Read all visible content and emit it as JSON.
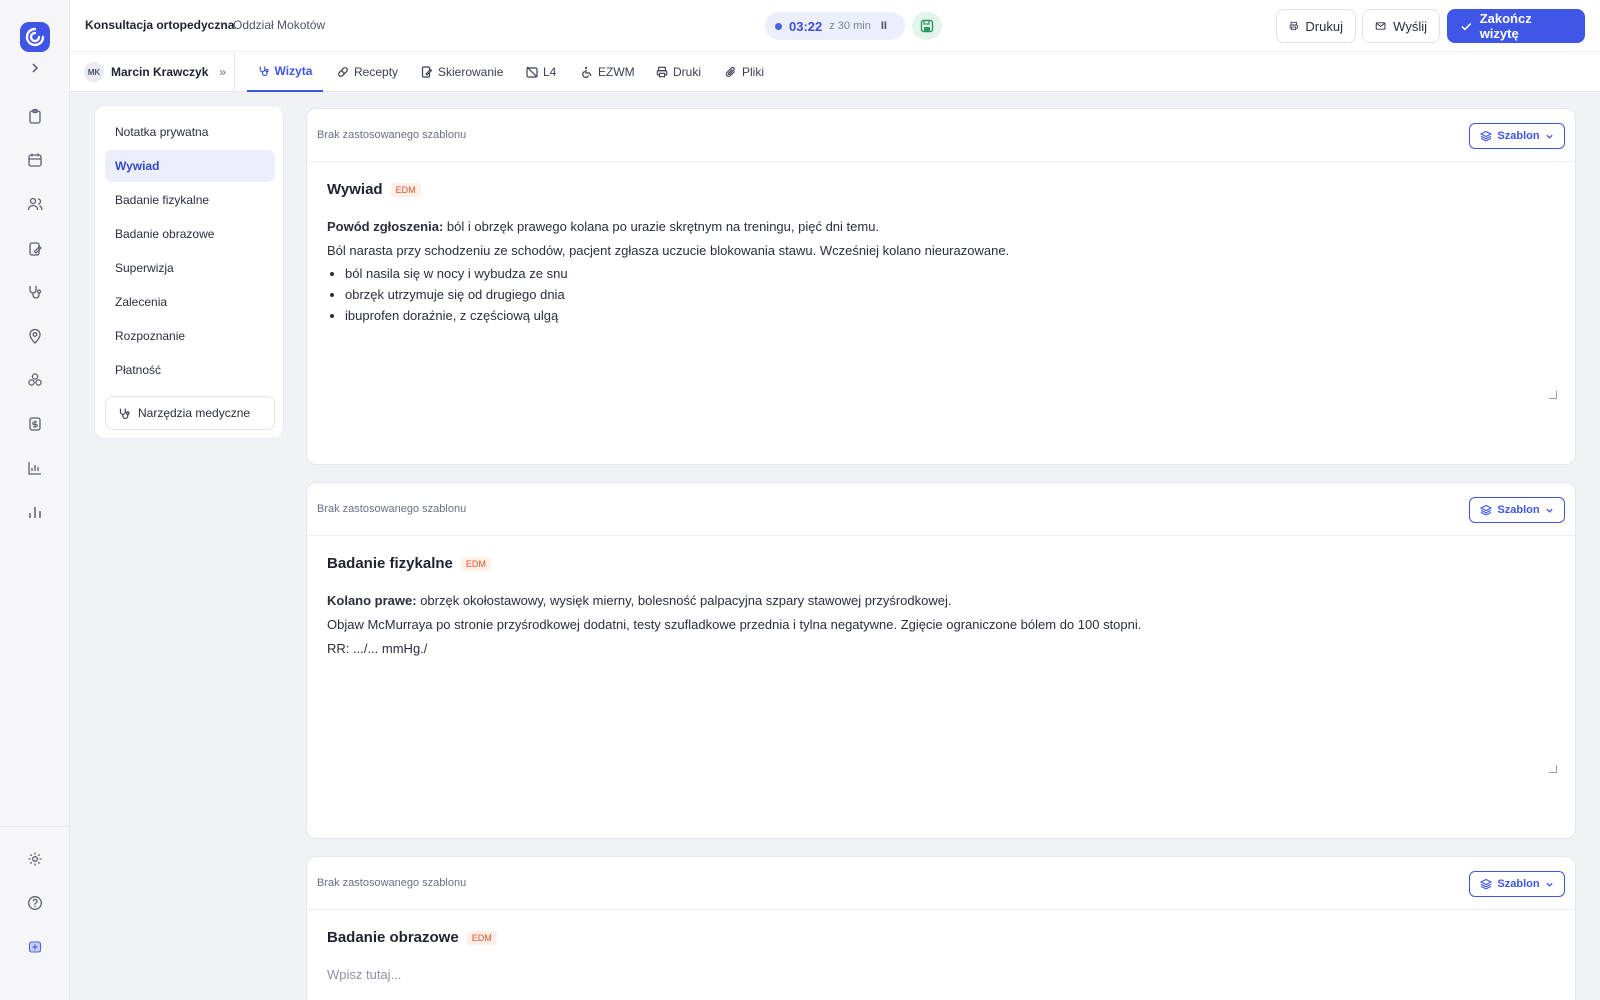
{
  "header": {
    "visit_type": "Konsultacja ortopedyczna",
    "separator": "·",
    "department": "Oddział Mokotów",
    "timer": {
      "time": "03:22",
      "of": "z 30 min",
      "pause_glyph": "II"
    },
    "buttons": {
      "print": "Drukuj",
      "send": "Wyślij",
      "finish": "Zakończ wizytę"
    }
  },
  "patient": {
    "initials": "MK",
    "name": "Marcin Krawczyk",
    "more_glyph": "»"
  },
  "tabs": [
    {
      "label": "Wizyta",
      "icon": "stethoscope-icon",
      "active": true
    },
    {
      "label": "Recepty",
      "icon": "pill-icon"
    },
    {
      "label": "Skierowanie",
      "icon": "document-edit-icon"
    },
    {
      "label": "L4",
      "icon": "calendar-off-icon"
    },
    {
      "label": "EZWM",
      "icon": "wheelchair-icon"
    },
    {
      "label": "Druki",
      "icon": "printer-icon"
    },
    {
      "label": "Pliki",
      "icon": "paperclip-icon"
    }
  ],
  "section_nav": {
    "items": [
      {
        "label": "Notatka prywatna"
      },
      {
        "label": "Wywiad",
        "active": true
      },
      {
        "label": "Badanie fizykalne"
      },
      {
        "label": "Badanie obrazowe"
      },
      {
        "label": "Superwizja"
      },
      {
        "label": "Zalecenia"
      },
      {
        "label": "Rozpoznanie"
      },
      {
        "label": "Płatność"
      }
    ],
    "tools_button": "Narzędzia medyczne"
  },
  "sections": [
    {
      "template_status": "Brak zastosowanego szablonu",
      "template_button": "Szablon",
      "title": "Wywiad",
      "badge": "EDM",
      "lines": [
        {
          "bold": "Powód zgłoszenia:",
          "text": " ból i obrzęk prawego kolana po urazie skrętnym na treningu, pięć dni temu."
        },
        {
          "text": "Ból narasta przy schodzeniu ze schodów, pacjent zgłasza uczucie blokowania stawu. Wcześniej kolano nieurazowane."
        }
      ],
      "bullets": [
        "ból nasila się w nocy i wybudza ze snu",
        "obrzęk utrzymuje się od drugiego dnia",
        "ibuprofen doraźnie, z częściową ulgą"
      ]
    },
    {
      "template_status": "Brak zastosowanego szablonu",
      "template_button": "Szablon",
      "title": "Badanie fizykalne",
      "badge": "EDM",
      "lines": [
        {
          "bold": "Kolano prawe:",
          "text": " obrzęk okołostawowy, wysięk mierny, bolesność palpacyjna szpary stawowej przyśrodkowej."
        },
        {
          "text": "Objaw McMurraya po stronie przyśrodkowej dodatni, testy szufladkowe przednia i tylna negatywne. Zgięcie ograniczone bólem do 100 stopni."
        },
        {
          "text": "RR: .../... mmHg./"
        }
      ]
    },
    {
      "template_status": "Brak zastosowanego szablonu",
      "template_button": "Szablon",
      "title": "Badanie obrazowe",
      "badge": "EDM",
      "placeholder": "Wpisz tutaj..."
    }
  ],
  "colors": {
    "accent": "#3e55e6",
    "badge": "#d9542c",
    "save_bg": "#e3f4ea"
  }
}
